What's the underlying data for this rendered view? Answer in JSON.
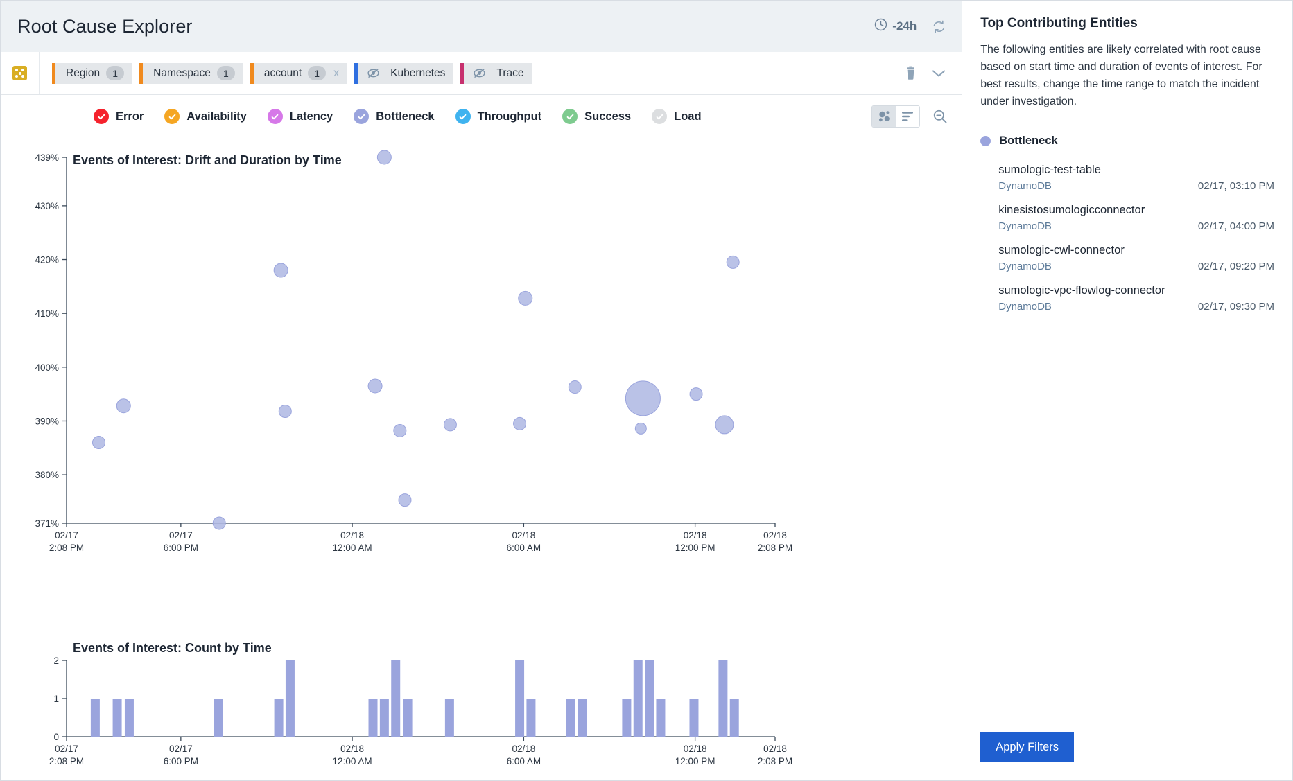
{
  "header": {
    "title": "Root Cause Explorer",
    "time_range": "-24h",
    "clock_icon": "clock-icon",
    "refresh_icon": "refresh-icon"
  },
  "filter_bar": {
    "grip_icon": "grid-handle-icon",
    "chips": [
      {
        "label": "Region",
        "count": "1",
        "color": "#f08a1e",
        "removable": false,
        "icon": null
      },
      {
        "label": "Namespace",
        "count": "1",
        "color": "#f08a1e",
        "removable": false,
        "icon": null
      },
      {
        "label": "account",
        "count": "1",
        "color": "#f08a1e",
        "removable": true,
        "remove_label": "x",
        "icon": null
      },
      {
        "label": "Kubernetes",
        "count": null,
        "color": "#2f6fe0",
        "removable": false,
        "icon": "eye-slash-icon"
      },
      {
        "label": "Trace",
        "count": null,
        "color": "#c7306e",
        "removable": false,
        "icon": "eye-slash-icon"
      }
    ],
    "delete_icon": "trash-icon",
    "collapse_icon": "chevron-down-icon"
  },
  "legend": [
    {
      "label": "Error",
      "color": "#f5222d"
    },
    {
      "label": "Availability",
      "color": "#f5a623"
    },
    {
      "label": "Latency",
      "color": "#d678e8"
    },
    {
      "label": "Bottleneck",
      "color": "#9aa4dd"
    },
    {
      "label": "Throughput",
      "color": "#3fb3ef"
    },
    {
      "label": "Success",
      "color": "#7ecb8f"
    },
    {
      "label": "Load",
      "color": "#dcdee0"
    }
  ],
  "chart_tools": {
    "scatter_view_icon": "scatter-view-icon",
    "list_view_icon": "list-view-icon",
    "zoom_out_icon": "zoom-out-icon"
  },
  "chart_data": [
    {
      "id": "scatter",
      "type": "scatter",
      "title": "Events of Interest: Drift and Duration by Time",
      "xlabel": "",
      "ylabel": "",
      "ylim": [
        371,
        439
      ],
      "ytick_labels": [
        "439%",
        "430%",
        "420%",
        "410%",
        "400%",
        "390%",
        "380%",
        "371%"
      ],
      "ytick_values": [
        439,
        430,
        420,
        410,
        400,
        390,
        380,
        371
      ],
      "xtick_labels": [
        [
          "02/17",
          "2:08 PM"
        ],
        [
          "02/17",
          "6:00 PM"
        ],
        [
          "02/18",
          "12:00 AM"
        ],
        [
          "02/18",
          "6:00 AM"
        ],
        [
          "02/18",
          "12:00 PM"
        ],
        [
          "02/18",
          "2:08 PM"
        ]
      ],
      "xtick_positions": [
        0,
        0.1613,
        0.4032,
        0.6452,
        0.8871,
        1.0
      ],
      "grid": false,
      "point_color": "#aeb7e3",
      "point_stroke": "#9aa4dd",
      "points": [
        {
          "x": 0.0455,
          "y": 386.0,
          "r": 9
        },
        {
          "x": 0.0805,
          "y": 392.8,
          "r": 10
        },
        {
          "x": 0.2155,
          "y": 371.0,
          "r": 9
        },
        {
          "x": 0.3025,
          "y": 418.0,
          "r": 10
        },
        {
          "x": 0.3085,
          "y": 391.8,
          "r": 9
        },
        {
          "x": 0.4485,
          "y": 439.0,
          "r": 10
        },
        {
          "x": 0.4355,
          "y": 396.5,
          "r": 10
        },
        {
          "x": 0.4705,
          "y": 388.2,
          "r": 9
        },
        {
          "x": 0.4775,
          "y": 375.3,
          "r": 9
        },
        {
          "x": 0.5415,
          "y": 389.3,
          "r": 9
        },
        {
          "x": 0.6395,
          "y": 389.5,
          "r": 9
        },
        {
          "x": 0.6475,
          "y": 412.8,
          "r": 10
        },
        {
          "x": 0.7175,
          "y": 396.3,
          "r": 9
        },
        {
          "x": 0.8135,
          "y": 394.2,
          "r": 25
        },
        {
          "x": 0.8105,
          "y": 388.6,
          "r": 8
        },
        {
          "x": 0.8885,
          "y": 395.0,
          "r": 9
        },
        {
          "x": 0.9405,
          "y": 419.5,
          "r": 9
        },
        {
          "x": 0.9285,
          "y": 389.3,
          "r": 13
        }
      ]
    },
    {
      "id": "count-bars",
      "type": "bar",
      "title": "Events of Interest: Count by Time",
      "xlabel": "",
      "ylabel": "",
      "ylim": [
        0,
        2
      ],
      "ytick_labels": [
        "0",
        "1",
        "2"
      ],
      "ytick_values": [
        0,
        1,
        2
      ],
      "xtick_labels": [
        [
          "02/17",
          "2:08 PM"
        ],
        [
          "02/17",
          "6:00 PM"
        ],
        [
          "02/18",
          "12:00 AM"
        ],
        [
          "02/18",
          "6:00 AM"
        ],
        [
          "02/18",
          "12:00 PM"
        ],
        [
          "02/18",
          "2:08 PM"
        ]
      ],
      "xtick_positions": [
        0,
        0.1613,
        0.4032,
        0.6452,
        0.8871,
        1.0
      ],
      "grid": false,
      "bar_color": "#9aa4dd",
      "bars": [
        {
          "x": 0.0405,
          "value": 1
        },
        {
          "x": 0.0715,
          "value": 1
        },
        {
          "x": 0.0885,
          "value": 1
        },
        {
          "x": 0.2145,
          "value": 1
        },
        {
          "x": 0.2995,
          "value": 1
        },
        {
          "x": 0.3155,
          "value": 2
        },
        {
          "x": 0.4325,
          "value": 1
        },
        {
          "x": 0.4485,
          "value": 1
        },
        {
          "x": 0.4645,
          "value": 2
        },
        {
          "x": 0.4815,
          "value": 1
        },
        {
          "x": 0.5405,
          "value": 1
        },
        {
          "x": 0.6395,
          "value": 2
        },
        {
          "x": 0.6555,
          "value": 1
        },
        {
          "x": 0.7115,
          "value": 1
        },
        {
          "x": 0.7275,
          "value": 1
        },
        {
          "x": 0.7905,
          "value": 1
        },
        {
          "x": 0.8065,
          "value": 2
        },
        {
          "x": 0.8225,
          "value": 2
        },
        {
          "x": 0.8385,
          "value": 1
        },
        {
          "x": 0.8855,
          "value": 1
        },
        {
          "x": 0.9265,
          "value": 2
        },
        {
          "x": 0.9425,
          "value": 1
        }
      ]
    }
  ],
  "sidebar": {
    "title": "Top Contributing Entities",
    "description": "The following entities are likely correlated with root cause based on start time and duration of events of interest. For best results, change the time range to match the incident under investigation.",
    "groups": [
      {
        "name": "Bottleneck",
        "color": "#9aa4dd",
        "entities": [
          {
            "name": "sumologic-test-table",
            "type": "DynamoDB",
            "time": "02/17, 03:10 PM"
          },
          {
            "name": "kinesistosumologicconnector",
            "type": "DynamoDB",
            "time": "02/17, 04:00 PM"
          },
          {
            "name": "sumologic-cwl-connector",
            "type": "DynamoDB",
            "time": "02/17, 09:20 PM"
          },
          {
            "name": "sumologic-vpc-flowlog-connector",
            "type": "DynamoDB",
            "time": "02/17, 09:30 PM"
          }
        ]
      }
    ],
    "apply_button": "Apply Filters"
  }
}
